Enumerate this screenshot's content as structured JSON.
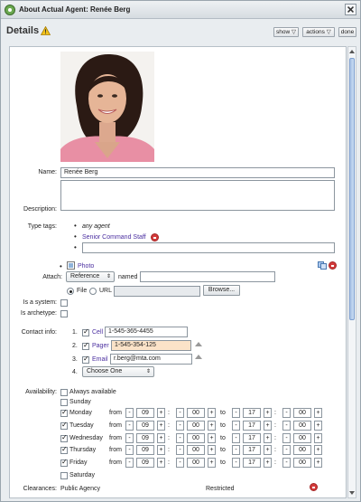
{
  "window": {
    "title": "About Actual Agent: Renée Berg"
  },
  "header": {
    "title": "Details",
    "show_label": "show ▽",
    "actions_label": "actions ▽",
    "done_label": "done"
  },
  "form": {
    "name_label": "Name:",
    "name_value": "Renée Berg",
    "description_label": "Description:",
    "type_tags_label": "Type tags:",
    "tag_any": "any agent",
    "tag_senior": "Senior Command Staff",
    "photo_link": "Photo",
    "attach_label": "Attach:",
    "attach_select": "Reference",
    "named_label": "named",
    "file_label": "File",
    "url_label": "URL",
    "browse_label": "Browse...",
    "is_system_label": "Is a system:",
    "is_archetype_label": "Is archetype:",
    "contact_label": "Contact info:",
    "contacts": [
      {
        "num": "1.",
        "type": "Cell",
        "value": "1-545-365-4455"
      },
      {
        "num": "2.",
        "type": "Pager",
        "value": "1-545-354-125"
      },
      {
        "num": "3.",
        "type": "Email",
        "value": "r.berg@mta.com"
      }
    ],
    "contact4_num": "4.",
    "choose_one": "Choose One",
    "availability_label": "Availability:",
    "always_available": "Always available",
    "from_label": "from",
    "to_label": "to",
    "minus": "-",
    "plus": "+",
    "colon": ":",
    "days": [
      {
        "name": "Sunday",
        "checked": false
      },
      {
        "name": "Monday",
        "checked": true,
        "from_h": "09",
        "from_m": "00",
        "to_h": "17",
        "to_m": "00"
      },
      {
        "name": "Tuesday",
        "checked": true,
        "from_h": "09",
        "from_m": "00",
        "to_h": "17",
        "to_m": "00"
      },
      {
        "name": "Wednesday",
        "checked": true,
        "from_h": "09",
        "from_m": "00",
        "to_h": "17",
        "to_m": "00"
      },
      {
        "name": "Thursday",
        "checked": true,
        "from_h": "09",
        "from_m": "00",
        "to_h": "17",
        "to_m": "00"
      },
      {
        "name": "Friday",
        "checked": true,
        "from_h": "09",
        "from_m": "00",
        "to_h": "17",
        "to_m": "00"
      },
      {
        "name": "Saturday",
        "checked": false
      }
    ],
    "clearances_label": "Clearances:",
    "clearance_value": "Public Agency",
    "clearance_level": "Restricted"
  }
}
